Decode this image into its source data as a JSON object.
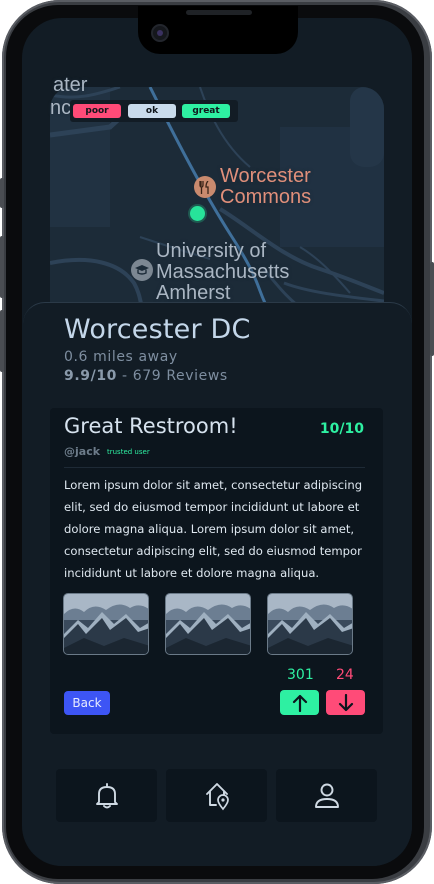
{
  "map": {
    "labels": {
      "top_left_fragment_1": "ater",
      "top_left_fragment_2": "nc",
      "poi_name_line1": "Worcester",
      "poi_name_line2": "Commons",
      "university_line1": "University of",
      "university_line2": "Massachusetts",
      "university_line3": "Amherst"
    },
    "legend": {
      "poor": "poor",
      "ok": "ok",
      "great": "great"
    },
    "colors": {
      "poor": "#ff4b78",
      "ok": "#c9dbec",
      "great": "#2ef0a2"
    },
    "icons": {
      "poi": "fork-knife-icon",
      "university": "graduation-cap-icon",
      "user": "location-dot-icon"
    }
  },
  "location": {
    "name": "Worcester DC",
    "distance": "0.6 miles away",
    "rating": "9.9/10",
    "reviews_text": " - 679 Reviews"
  },
  "review": {
    "title": "Great Restroom!",
    "score": "10/10",
    "user": "@jack",
    "badge": "trusted user",
    "body": "Lorem ipsum dolor sit amet, consectetur adipiscing elit, sed do eiusmod tempor incididunt ut labore et dolore magna aliqua. Lorem ipsum dolor sit amet, consectetur adipiscing elit, sed do eiusmod tempor incididunt ut labore et dolore magna aliqua.",
    "upvotes": "301",
    "downvotes": "24",
    "back_label": "Back",
    "photos": [
      "mountain-photo",
      "mountain-photo",
      "mountain-photo"
    ]
  },
  "nav": {
    "items": [
      {
        "icon": "bell-icon"
      },
      {
        "icon": "home-pin-icon"
      },
      {
        "icon": "user-icon"
      }
    ]
  }
}
